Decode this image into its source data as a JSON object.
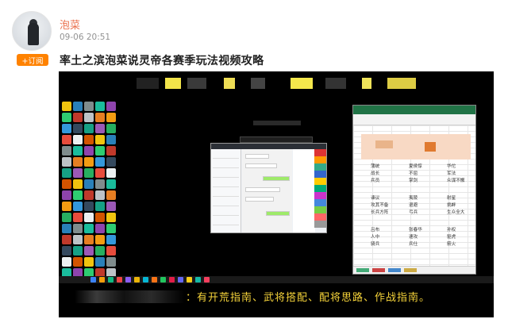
{
  "post": {
    "author": "泡菜",
    "time": "09-06 20:51",
    "subscribe_label": "+订阅",
    "title": "率土之滨泡菜说灵帝各赛季玩法视频攻略"
  },
  "video": {
    "subtitle": "：有开荒指南、武将搭配、配将思路、作战指南。",
    "excel_cells": [
      {
        "text": "蒲统"
      },
      {
        "text": "夏侯惇"
      },
      {
        "text": "华佗"
      },
      {
        "text": "战长"
      },
      {
        "text": "不屈"
      },
      {
        "text": "军法"
      },
      {
        "text": "兵员"
      },
      {
        "text": "掌剑"
      },
      {
        "text": "众谋不懈"
      },
      {
        "text": "谏议"
      },
      {
        "text": "夷陵"
      },
      {
        "text": "射星"
      },
      {
        "text": "攻其不备"
      },
      {
        "text": "退避"
      },
      {
        "text": "挑衅"
      },
      {
        "text": "长兵方阵"
      },
      {
        "text": "弓兵"
      },
      {
        "text": "生众全大"
      },
      {
        "text": "吕布"
      },
      {
        "text": "张春华"
      },
      {
        "text": "孙权"
      },
      {
        "text": "人中"
      },
      {
        "text": "速攻"
      },
      {
        "text": "驱虎"
      },
      {
        "text": "骑兵"
      },
      {
        "text": "兵仕"
      },
      {
        "text": "箭火"
      }
    ]
  },
  "colors": {
    "author": "#eb7350",
    "subscribe_bg": "#ff8200",
    "subtitle": "#f5d33a",
    "excel_header": "#217346"
  },
  "icons": {
    "avatar": "user-avatar-icon"
  }
}
